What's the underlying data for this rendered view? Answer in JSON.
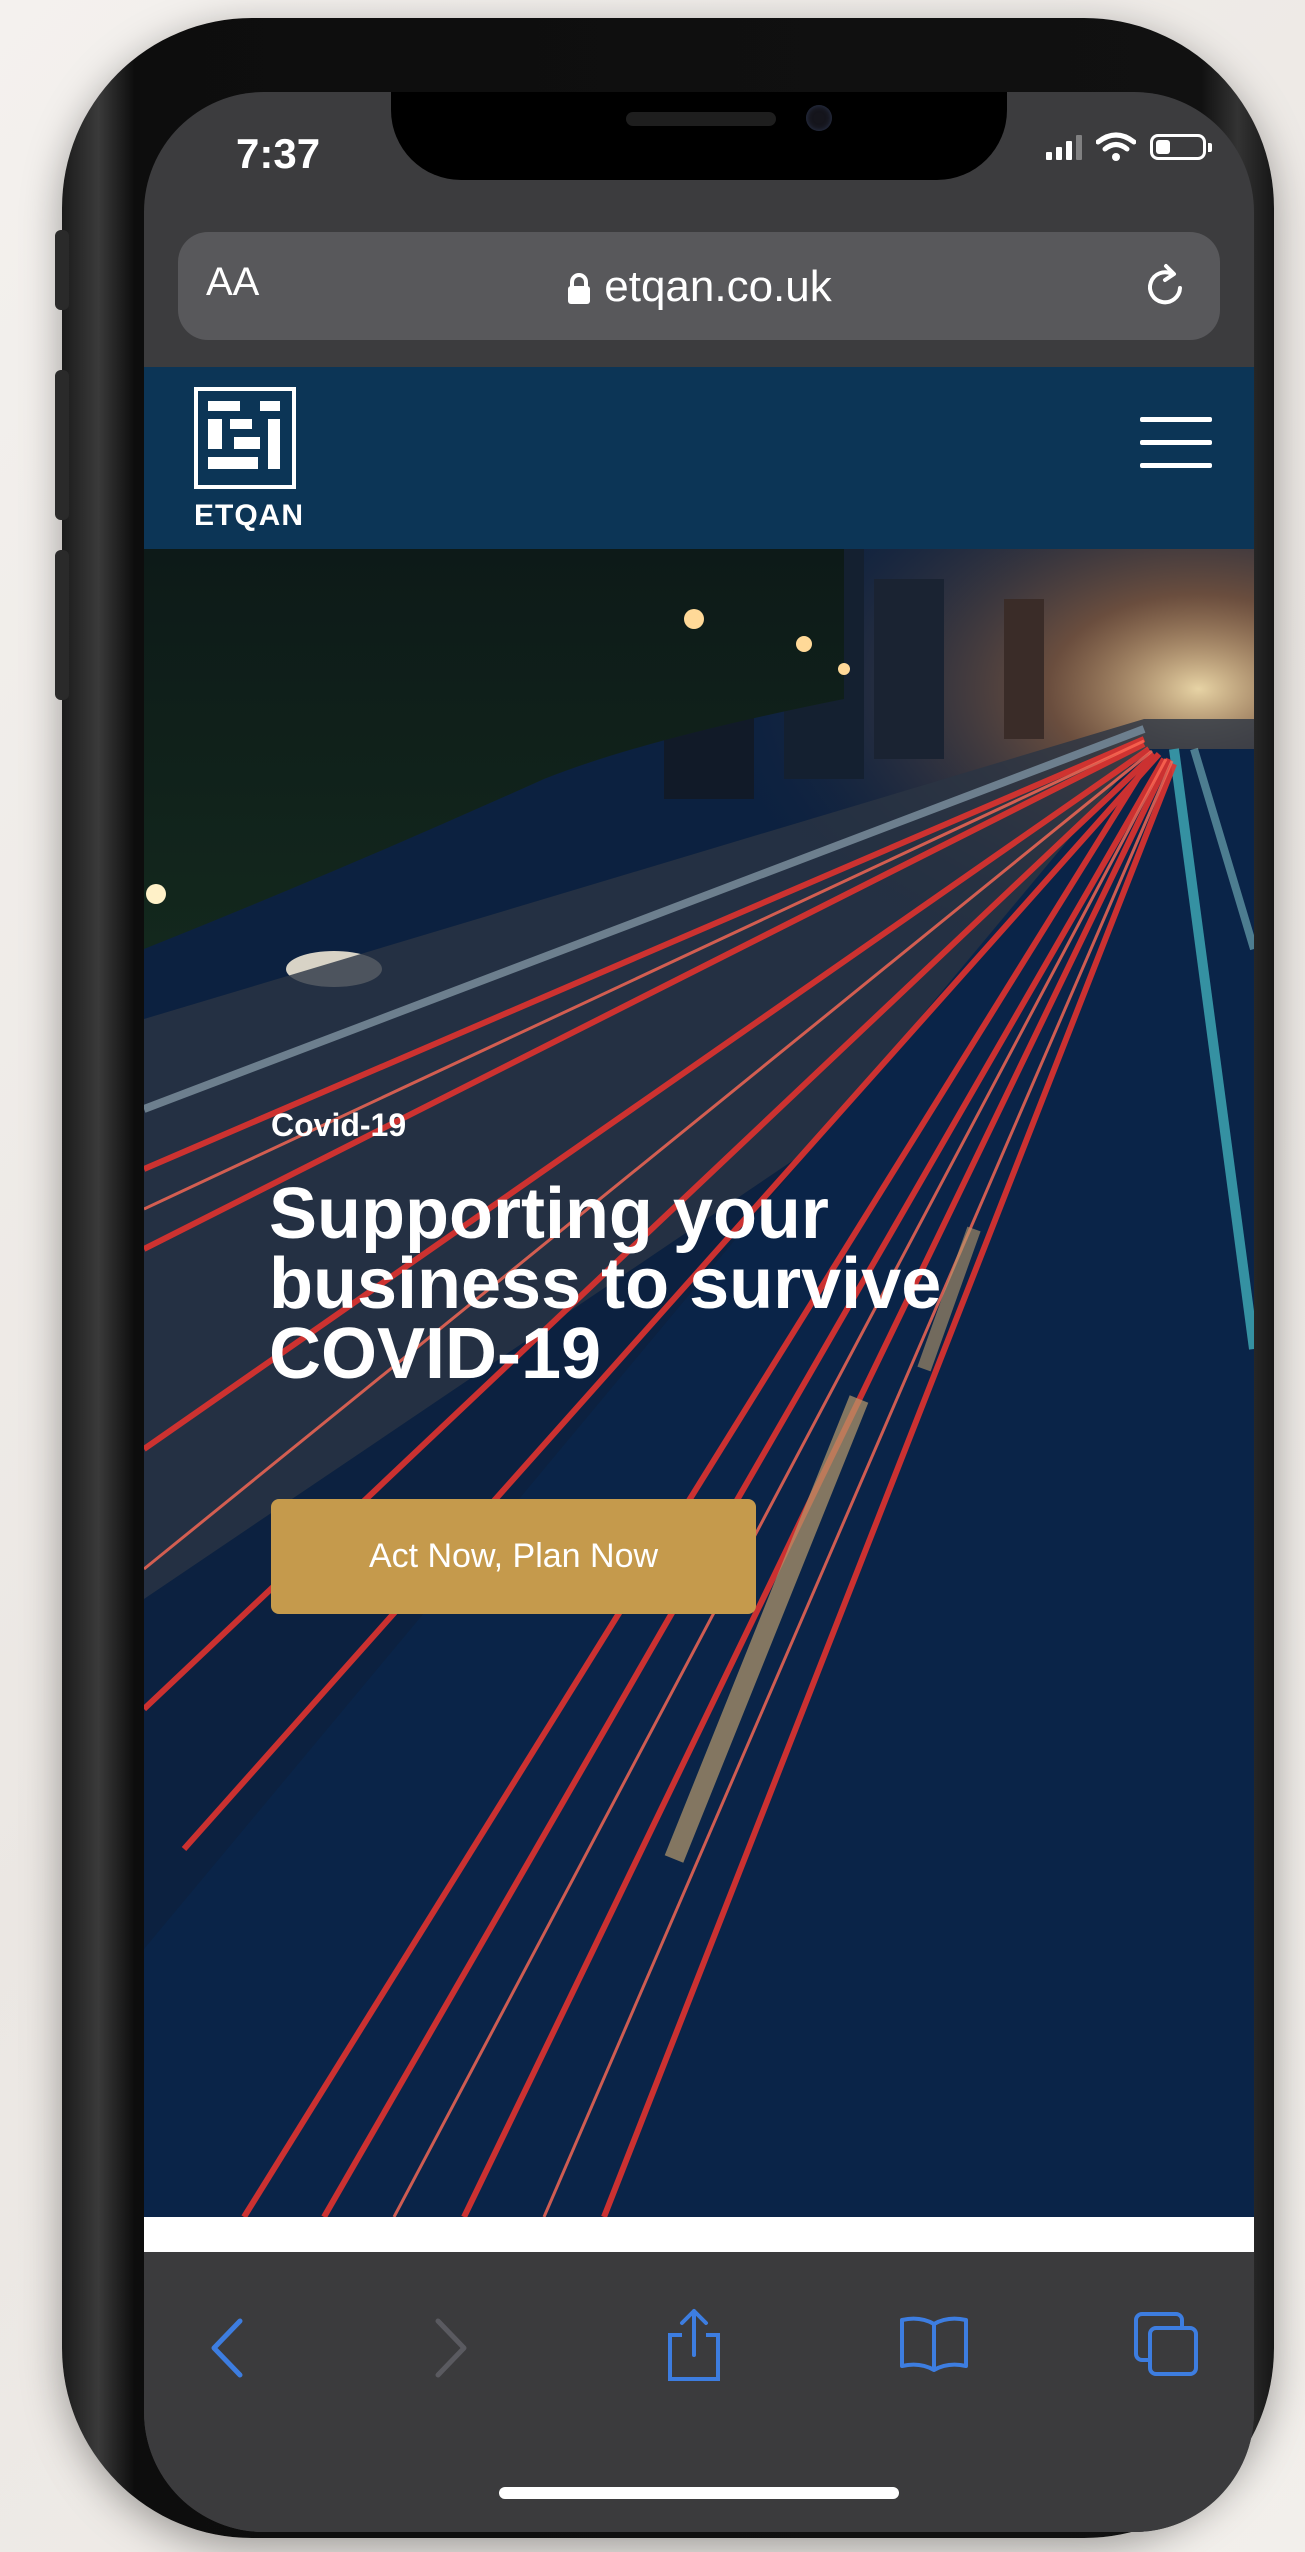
{
  "status": {
    "time": "7:37"
  },
  "browser": {
    "text_size_label": "AA",
    "url": "etqan.co.uk"
  },
  "site": {
    "logo_text": "ETQAN",
    "hero": {
      "kicker": "Covid-19",
      "headline": "Supporting your business to survive COVID-19",
      "cta_label": "Act Now, Plan Now"
    }
  },
  "icons": [
    "lock-icon",
    "reload-icon",
    "menu-icon",
    "back-icon",
    "forward-icon",
    "share-icon",
    "bookmarks-icon",
    "tabs-icon",
    "wifi-icon",
    "signal-icon",
    "battery-icon"
  ],
  "colors": {
    "header_bg": "#0c3556",
    "cta_bg": "#c59a4c",
    "toolbar_bg": "#3b3b3d",
    "toolbar_icon": "#3d7de0"
  }
}
